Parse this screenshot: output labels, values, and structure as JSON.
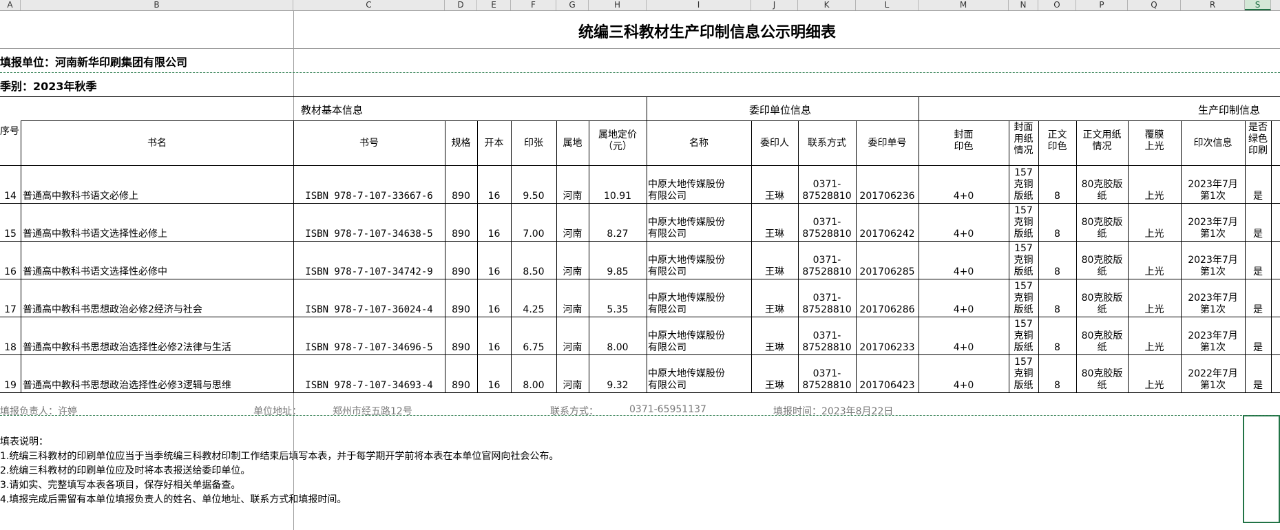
{
  "columns": [
    "A",
    "B",
    "C",
    "D",
    "E",
    "F",
    "G",
    "H",
    "I",
    "J",
    "K",
    "L",
    "M",
    "N",
    "O",
    "P",
    "Q",
    "R",
    "S"
  ],
  "sheet": {
    "title": "统编三科教材生产印制信息公示明细表",
    "unit_label": "填报单位：河南新华印刷集团有限公司",
    "season_label": "季别：2023年秋季"
  },
  "groups": {
    "basic": "教材基本信息",
    "client": "委印单位信息",
    "production": "生产印制信息"
  },
  "headers": {
    "seq": "序号",
    "name": "书名",
    "isbn": "书号",
    "spec": "规格",
    "format": "开本",
    "sheets": "印张",
    "region": "属地",
    "price_l1": "属地定价",
    "price_l2": "（元）",
    "client_name": "名称",
    "agent": "委印人",
    "contact": "联系方式",
    "order": "委印单号",
    "cover_color_l1": "封面",
    "cover_color_l2": "印色",
    "cover_paper": [
      "封面",
      "用纸",
      "情况"
    ],
    "text_color": [
      "正文",
      "印色"
    ],
    "text_paper": [
      "正文用纸",
      "情况"
    ],
    "lamination": [
      "覆膜",
      "上光"
    ],
    "print_info": "印次信息",
    "green": [
      "是否",
      "绿色",
      "印刷"
    ]
  },
  "rows": [
    {
      "seq": "14",
      "name": "普通高中教科书语文必修上",
      "isbn": "ISBN 978-7-107-33667-6",
      "spec": "890",
      "format": "16",
      "sheets": "9.50",
      "region": "河南",
      "price": "10.91",
      "client": [
        "中原大地传媒股份",
        "有限公司"
      ],
      "agent": "王琳",
      "contact": [
        "0371-",
        "87528810"
      ],
      "order": "201706236",
      "cover_color": "4+0",
      "cover_paper": [
        "157",
        "克铜",
        "版纸"
      ],
      "text_color": "8",
      "text_paper": [
        "80克胶版",
        "纸"
      ],
      "lamination": "上光",
      "print_info": [
        "2023年7月",
        "第1次"
      ],
      "green": "是"
    },
    {
      "seq": "15",
      "name": "普通高中教科书语文选择性必修上",
      "isbn": "ISBN 978-7-107-34638-5",
      "spec": "890",
      "format": "16",
      "sheets": "7.00",
      "region": "河南",
      "price": "8.27",
      "client": [
        "中原大地传媒股份",
        "有限公司"
      ],
      "agent": "王琳",
      "contact": [
        "0371-",
        "87528810"
      ],
      "order": "201706242",
      "cover_color": "4+0",
      "cover_paper": [
        "157",
        "克铜",
        "版纸"
      ],
      "text_color": "8",
      "text_paper": [
        "80克胶版",
        "纸"
      ],
      "lamination": "上光",
      "print_info": [
        "2023年7月",
        "第1次"
      ],
      "green": "是"
    },
    {
      "seq": "16",
      "name": "普通高中教科书语文选择性必修中",
      "isbn": "ISBN 978-7-107-34742-9",
      "spec": "890",
      "format": "16",
      "sheets": "8.50",
      "region": "河南",
      "price": "9.85",
      "client": [
        "中原大地传媒股份",
        "有限公司"
      ],
      "agent": "王琳",
      "contact": [
        "0371-",
        "87528810"
      ],
      "order": "201706285",
      "cover_color": "4+0",
      "cover_paper": [
        "157",
        "克铜",
        "版纸"
      ],
      "text_color": "8",
      "text_paper": [
        "80克胶版",
        "纸"
      ],
      "lamination": "上光",
      "print_info": [
        "2023年7月",
        "第1次"
      ],
      "green": "是"
    },
    {
      "seq": "17",
      "name": "普通高中教科书思想政治必修2经济与社会",
      "isbn": "ISBN 978-7-107-36024-4",
      "spec": "890",
      "format": "16",
      "sheets": "4.25",
      "region": "河南",
      "price": "5.35",
      "client": [
        "中原大地传媒股份",
        "有限公司"
      ],
      "agent": "王琳",
      "contact": [
        "0371-",
        "87528810"
      ],
      "order": "201706286",
      "cover_color": "4+0",
      "cover_paper": [
        "157",
        "克铜",
        "版纸"
      ],
      "text_color": "8",
      "text_paper": [
        "80克胶版",
        "纸"
      ],
      "lamination": "上光",
      "print_info": [
        "2023年7月",
        "第1次"
      ],
      "green": "是"
    },
    {
      "seq": "18",
      "name": "普通高中教科书思想政治选择性必修2法律与生活",
      "isbn": "ISBN 978-7-107-34696-5",
      "spec": "890",
      "format": "16",
      "sheets": "6.75",
      "region": "河南",
      "price": "8.00",
      "client": [
        "中原大地传媒股份",
        "有限公司"
      ],
      "agent": "王琳",
      "contact": [
        "0371-",
        "87528810"
      ],
      "order": "201706233",
      "cover_color": "4+0",
      "cover_paper": [
        "157",
        "克铜",
        "版纸"
      ],
      "text_color": "8",
      "text_paper": [
        "80克胶版",
        "纸"
      ],
      "lamination": "上光",
      "print_info": [
        "2023年7月",
        "第1次"
      ],
      "green": "是"
    },
    {
      "seq": "19",
      "name": "普通高中教科书思想政治选择性必修3逻辑与思维",
      "isbn": "ISBN 978-7-107-34693-4",
      "spec": "890",
      "format": "16",
      "sheets": "8.00",
      "region": "河南",
      "price": "9.32",
      "client": [
        "中原大地传媒股份",
        "有限公司"
      ],
      "agent": "王琳",
      "contact": [
        "0371-",
        "87528810"
      ],
      "order": "201706423",
      "cover_color": "4+0",
      "cover_paper": [
        "157",
        "克铜",
        "版纸"
      ],
      "text_color": "8",
      "text_paper": [
        "80克胶版",
        "纸"
      ],
      "lamination": "上光",
      "print_info": [
        "2022年7月",
        "第1次"
      ],
      "green": "是"
    }
  ],
  "footer": {
    "responsible": "填报负责人：许婷",
    "address_label": "单位地址：",
    "address": "郑州市经五路12号",
    "contact_label": "联系方式：",
    "contact": "0371-65951137",
    "date": "填报时间：2023年8月22日"
  },
  "notes": [
    "填表说明：",
    "1.统编三科教材的印刷单位应当于当季统编三科教材印制工作结束后填写本表，并于每学期开学前将本表在本单位官网向社会公布。",
    "2.统编三科教材的印刷单位应及时将本表报送给委印单位。",
    "3.请如实、完整填写本表各项目，保存好相关单据备查。",
    "4.填报完成后需留有本单位填报负责人的姓名、单位地址、联系方式和填报时间。"
  ]
}
